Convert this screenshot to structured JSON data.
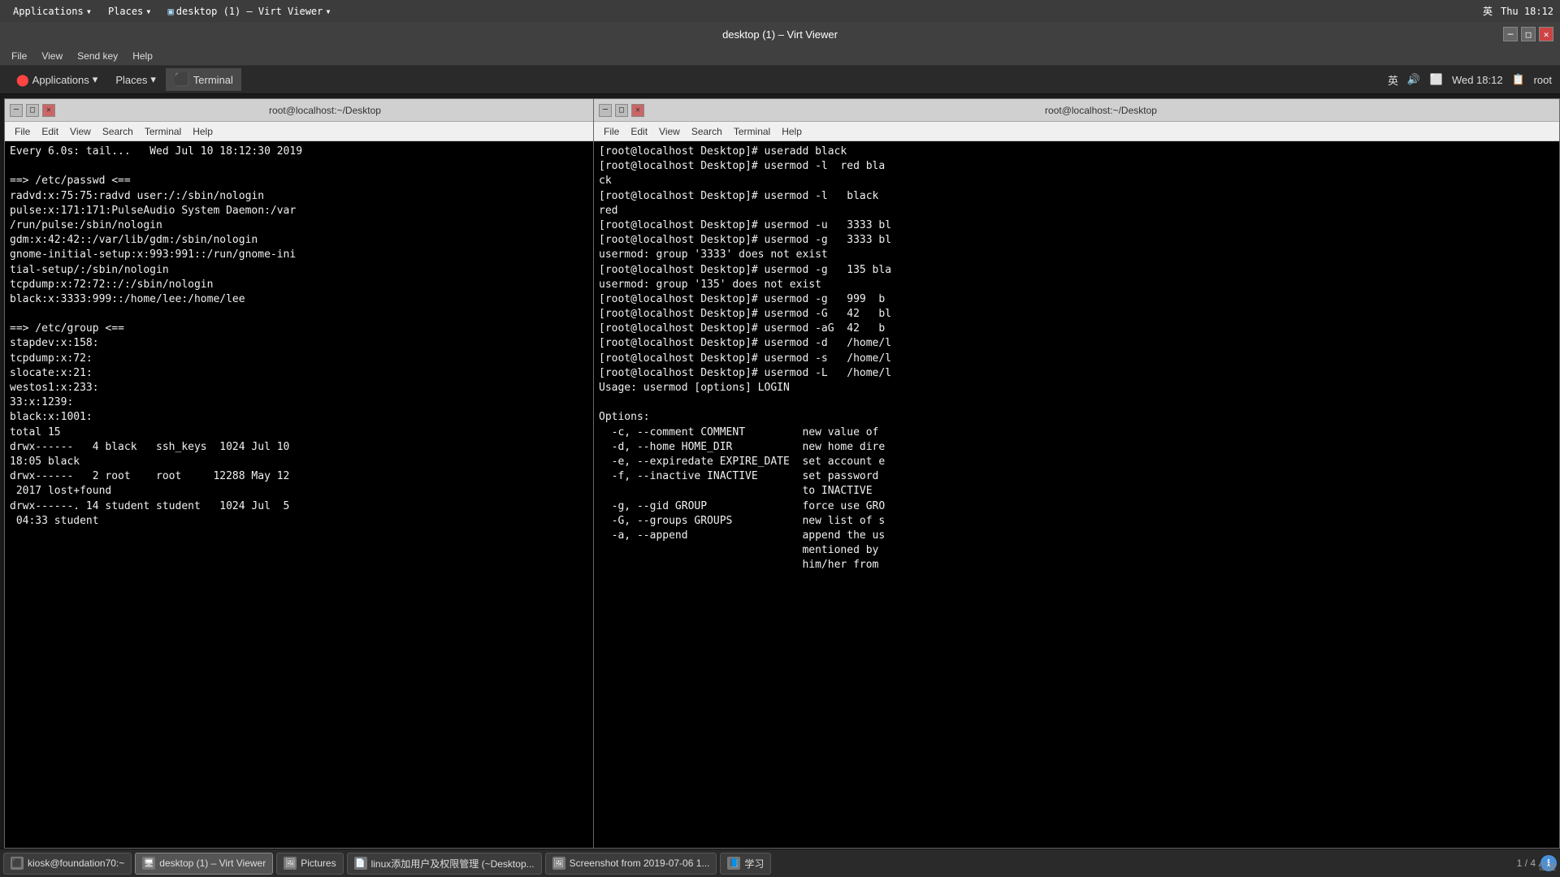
{
  "host": {
    "topbar": {
      "applications_label": "Applications",
      "places_label": "Places",
      "viewer_label": "desktop (1) – Virt Viewer",
      "lang": "英",
      "time": "Thu 18:12"
    }
  },
  "virt_viewer": {
    "title": "desktop (1) – Virt Viewer",
    "menu": {
      "file": "File",
      "view": "View",
      "send_key": "Send key",
      "help": "Help"
    }
  },
  "guest": {
    "topbar": {
      "applications": "Applications",
      "places": "Places",
      "terminal_label": "Terminal",
      "lang": "英",
      "time": "Wed 18:12",
      "username": "root"
    },
    "terminal_left": {
      "title": "root@localhost:~/Desktop",
      "menu": {
        "file": "File",
        "edit": "Edit",
        "view": "View",
        "search": "Search",
        "terminal": "Terminal",
        "help": "Help"
      },
      "content": "Every 6.0s: tail...   Wed Jul 10 18:12:30 2019\n\n==> /etc/passwd <==\nradvd:x:75:75:radvd user:/:/sbin/nologin\npulse:x:171:171:PulseAudio System Daemon:/var\n/run/pulse:/sbin/nologin\ngdm:x:42:42::/var/lib/gdm:/sbin/nologin\ngnome-initial-setup:x:993:991::/run/gnome-ini\ntial-setup/:/sbin/nologin\ntcpdump:x:72:72::/:/sbin/nologin\nblack:x:3333:999::/home/lee:/home/lee\n\n==> /etc/group <==\nstapdev:x:158:\ntcpdump:x:72:\nslocate:x:21:\nwestos1:x:233:\n33:x:1239:\nblack:x:1001:\ntotal 15\ndrwx------   4 black   ssh_keys  1024 Jul 10\n18:05 black\ndrwx------   2 root    root     12288 May 12\n 2017 lost+found\ndrwx------. 14 student student   1024 Jul  5\n 04:33 student"
    },
    "terminal_right": {
      "title": "root@localhost:~/Desktop",
      "menu": {
        "file": "File",
        "edit": "Edit",
        "view": "View",
        "search": "Search",
        "terminal": "Terminal",
        "help": "Help"
      },
      "content": "[root@localhost Desktop]# useradd black\n[root@localhost Desktop]# usermod -l  red bla\nck\n[root@localhost Desktop]# usermod -l   black\nred\n[root@localhost Desktop]# usermod -u   3333 bl\n[root@localhost Desktop]# usermod -g   3333 bl\nusermod: group '3333' does not exist\n[root@localhost Desktop]# usermod -g   135 bla\nusermod: group '135' does not exist\n[root@localhost Desktop]# usermod -g   999  b\n[root@localhost Desktop]# usermod -G   42   bl\n[root@localhost Desktop]# usermod -aG  42   b\n[root@localhost Desktop]# usermod -d   /home/l\n[root@localhost Desktop]# usermod -s   /home/l\n[root@localhost Desktop]# usermod -L   /home/l\nUsage: usermod [options] LOGIN\n\nOptions:\n  -c, --comment COMMENT         new value of\n  -d, --home HOME_DIR           new home dire\n  -e, --expiredate EXPIRE_DATE  set account e\n  -f, --inactive INACTIVE       set password\n                                to INACTIVE\n  -g, --gid GROUP               force use GRO\n  -G, --groups GROUPS           new list of s\n  -a, --append                  append the us\n                                mentioned by\n                                him/her from"
    },
    "taskbar": {
      "items": [
        {
          "id": "kiosk",
          "label": "kiosk@foundation70:~",
          "icon": "▣"
        },
        {
          "id": "virt",
          "label": "desktop (1) – Virt Viewer",
          "icon": "▣",
          "active": true
        },
        {
          "id": "pictures",
          "label": "Pictures",
          "icon": "▣"
        },
        {
          "id": "linux-mgmt",
          "label": "linux添加用户及权限管理 (~Desktop...",
          "icon": "▣"
        },
        {
          "id": "screenshot",
          "label": "Screenshot from 2019-07-06 1...",
          "icon": "▣"
        },
        {
          "id": "study",
          "label": "学习",
          "icon": "▣"
        }
      ],
      "page_info": "1 / 4",
      "bottom_right": "亿迪"
    }
  }
}
